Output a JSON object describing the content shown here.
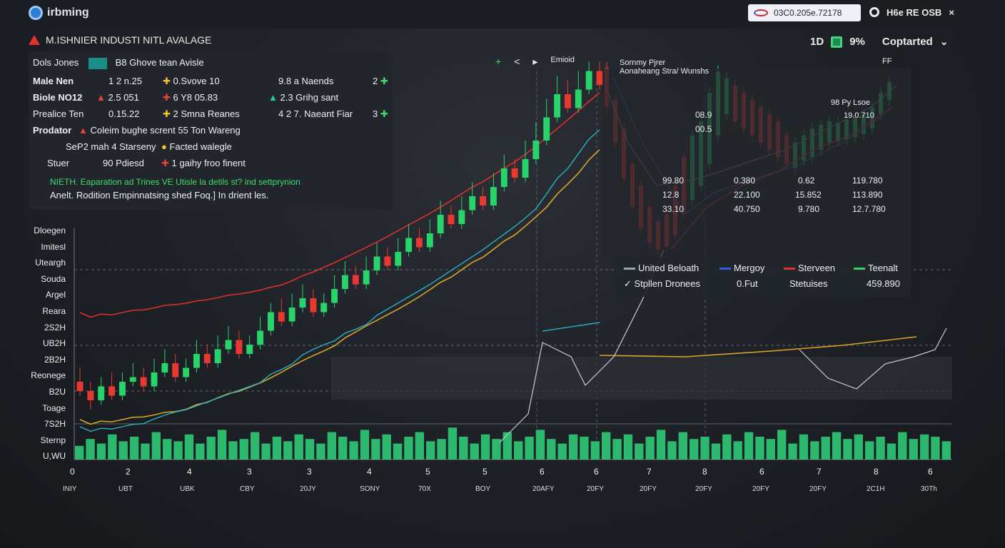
{
  "app": {
    "name": "irbming"
  },
  "ticker": {
    "value": "03C0.205e.72178"
  },
  "top_right": {
    "label": "H6e RE OSB",
    "close": "×"
  },
  "headline": {
    "text": "M.ISHNIER INDUSTI NITL AVALAGE"
  },
  "stats": {
    "count": "1D",
    "percent": "9%",
    "label": "Coptarted",
    "chev": "⌄"
  },
  "panel": {
    "title": "Dols Jones",
    "title_right": "B8 Ghove tean Avisle",
    "rows": [
      {
        "label": "Male Nen",
        "v1": "1 2 n.25",
        "v2": "0.Svove 10",
        "v3": "9.8 a Naends",
        "v4": "2"
      },
      {
        "label": "Biole NO12",
        "v1": "2.5 051",
        "v2": "6 Y8 05.83",
        "v3": "2.3 Grihg sant"
      },
      {
        "label": "Prealice Ten",
        "v1": "0.15.22",
        "v2": "2 Smna Reanes",
        "v3": "4 2 7. Naeant Fiar",
        "v4": "3"
      },
      {
        "label": "Prodator",
        "v1": "Coleim bughe scrent 55 Ton Wareng"
      },
      {
        "label": "SeP2 mah 4 Starseny",
        "v1": "Facted walegle"
      },
      {
        "label": "Stuer",
        "v1": "90 Pdiesd",
        "v2": "1 gaihy froo finent"
      }
    ],
    "note_green": "NIETH. Eaparation ad Trines VE Utisle la detils st? ind settprynion",
    "note_white": "Anelt. Rodition Empinnatsing shed Foq.] In drient les."
  },
  "toolbar": {
    "plus": "+",
    "back": "<",
    "fwd": "▸",
    "label": "Emioid"
  },
  "overlay": {
    "head1": "Sornmy Pjrer",
    "head2": "Aonaheang   Stra/ Wunshs",
    "inner1": "08.9",
    "inner2": "00.5",
    "right1": "98 Py Lsoe",
    "right2": "19.0.710",
    "right3": "FF",
    "cols": [
      [
        "99.80",
        "12.8",
        "33.10"
      ],
      [
        "0.380",
        "22.100",
        "40.750"
      ],
      [
        "0.62",
        "15.852",
        "9.780"
      ],
      [
        "119.780",
        "113.890",
        "12.7.780"
      ]
    ]
  },
  "legend": {
    "items": [
      {
        "label": "United Beloath",
        "color": "#9aa3ae"
      },
      {
        "label": "Mergoy",
        "color": "#3a5bd9"
      },
      {
        "label": "Sterveen",
        "color": "#e0322b"
      },
      {
        "label": "Teenalt",
        "color": "#34d06a"
      }
    ],
    "row2_label": "Stpllen Dronees",
    "row2_v1": "0.Fut",
    "row2_v2": "Stetuises",
    "row2_v3": "459.890"
  },
  "chart_data": {
    "type": "candlestick",
    "ylabels": [
      "Dloegen",
      "Imitesl",
      "Uteargh",
      "Souda",
      "Argel",
      "Reara",
      "2S2H",
      "UB2H",
      "2B2H",
      "Reonege",
      "B2U",
      "Toage",
      "7S2H",
      "Sternp",
      "U,WU"
    ],
    "xlabels": [
      "0",
      "2",
      "4",
      "3",
      "3",
      "4",
      "5",
      "5",
      "6",
      "6",
      "7",
      "8",
      "6",
      "7",
      "8",
      "6"
    ],
    "xsub": [
      "INIY",
      "UBT",
      "UBK",
      "CBY",
      "20JY",
      "SONY",
      "70X",
      "BOY",
      "20AFY",
      "20FY",
      "20FY",
      "20FY",
      "20FY",
      "20FY",
      "2C1H",
      "30Th"
    ],
    "candles": [
      [
        30,
        28,
        33,
        27
      ],
      [
        28,
        26,
        30,
        24
      ],
      [
        26,
        29,
        31,
        25
      ],
      [
        29,
        27,
        32,
        26
      ],
      [
        27,
        30,
        32,
        26
      ],
      [
        30,
        31,
        34,
        29
      ],
      [
        31,
        29,
        33,
        28
      ],
      [
        29,
        32,
        35,
        28
      ],
      [
        32,
        34,
        37,
        31
      ],
      [
        34,
        31,
        36,
        30
      ],
      [
        31,
        33,
        35,
        30
      ],
      [
        33,
        36,
        39,
        32
      ],
      [
        36,
        34,
        38,
        33
      ],
      [
        34,
        37,
        40,
        33
      ],
      [
        37,
        39,
        42,
        36
      ],
      [
        39,
        36,
        41,
        35
      ],
      [
        36,
        38,
        40,
        35
      ],
      [
        38,
        41,
        44,
        37
      ],
      [
        41,
        45,
        47,
        40
      ],
      [
        45,
        43,
        48,
        42
      ],
      [
        43,
        46,
        49,
        42
      ],
      [
        46,
        48,
        51,
        45
      ],
      [
        48,
        45,
        50,
        44
      ],
      [
        45,
        47,
        49,
        44
      ],
      [
        47,
        50,
        53,
        46
      ],
      [
        50,
        53,
        56,
        49
      ],
      [
        53,
        51,
        55,
        50
      ],
      [
        51,
        54,
        57,
        50
      ],
      [
        54,
        57,
        60,
        53
      ],
      [
        57,
        55,
        59,
        54
      ],
      [
        55,
        58,
        61,
        54
      ],
      [
        58,
        61,
        64,
        57
      ],
      [
        61,
        59,
        63,
        58
      ],
      [
        59,
        62,
        65,
        58
      ],
      [
        62,
        66,
        69,
        61
      ],
      [
        66,
        64,
        68,
        63
      ],
      [
        64,
        67,
        70,
        63
      ],
      [
        67,
        70,
        73,
        66
      ],
      [
        70,
        68,
        72,
        67
      ],
      [
        68,
        72,
        75,
        67
      ],
      [
        72,
        76,
        79,
        71
      ],
      [
        76,
        74,
        78,
        73
      ],
      [
        74,
        78,
        82,
        73
      ],
      [
        78,
        82,
        86,
        77
      ],
      [
        82,
        87,
        91,
        81
      ],
      [
        87,
        92,
        96,
        86
      ],
      [
        92,
        89,
        95,
        88
      ],
      [
        89,
        93,
        97,
        88
      ],
      [
        93,
        97,
        99,
        92
      ],
      [
        97,
        94,
        99,
        93
      ]
    ],
    "volumes": [
      6,
      9,
      7,
      11,
      8,
      10,
      7,
      12,
      9,
      8,
      11,
      7,
      10,
      13,
      8,
      9,
      12,
      7,
      10,
      8,
      11,
      9,
      7,
      12,
      10,
      8,
      13,
      9,
      11,
      7,
      10,
      12,
      8,
      9,
      14,
      10,
      7,
      11,
      9,
      12,
      8,
      10,
      13,
      9,
      7,
      11,
      10,
      8,
      12,
      9,
      11,
      7,
      10,
      13,
      8,
      12,
      9,
      10,
      7,
      11,
      8,
      12,
      10,
      9,
      13,
      7,
      11,
      8,
      10,
      12,
      9,
      11,
      8,
      10,
      7,
      12,
      9,
      11,
      10,
      8
    ]
  },
  "colors": {
    "bull": "#27d36a",
    "bear": "#e7392f",
    "ma_red": "#d8322a",
    "ma_orange": "#d8a62a",
    "ma_cyan": "#2ab0c2",
    "volume": "#2fd47a"
  }
}
